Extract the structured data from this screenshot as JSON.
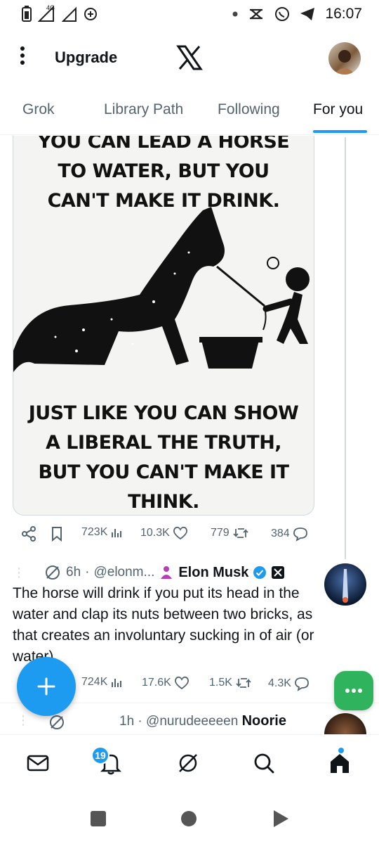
{
  "status_bar": {
    "time": "16:07",
    "network": "4G"
  },
  "top_bar": {
    "upgrade_label": "Upgrade"
  },
  "tabs": [
    {
      "label": "Grok"
    },
    {
      "label": "Library Path"
    },
    {
      "label": "Following"
    },
    {
      "label": "For you"
    }
  ],
  "meme": {
    "top_text_line1": "YOU CAN LEAD A HORSE",
    "top_text_line2": "TO WATER, BUT YOU",
    "top_text_line3": "CAN'T MAKE IT DRINK.",
    "bottom_text_line1": "JUST LIKE YOU CAN SHOW",
    "bottom_text_line2": "A LIBERAL THE TRUTH,",
    "bottom_text_line3": "BUT YOU CAN'T MAKE IT",
    "bottom_text_line4": "THINK."
  },
  "post1_actions": {
    "views": "723K",
    "likes": "10.3K",
    "reposts": "779",
    "replies": "384"
  },
  "reply1": {
    "time": "6h",
    "handle": "@elonm...",
    "name": "Elon Musk",
    "text": "The horse will drink if you put its head in the water and clap its nuts between two bricks, as that creates an involuntary sucking in of air (or water)",
    "views": "724K",
    "likes": "17.6K",
    "reposts": "1.5K",
    "replies": "4.3K"
  },
  "reply2": {
    "time": "1h",
    "handle": "@nurudeeeeen",
    "name": "Noorie"
  },
  "bottom_nav": {
    "notifications_badge": "19"
  },
  "colors": {
    "accent": "#1d9bf0",
    "grok_fab": "#2fb35c",
    "muted": "#536471"
  }
}
